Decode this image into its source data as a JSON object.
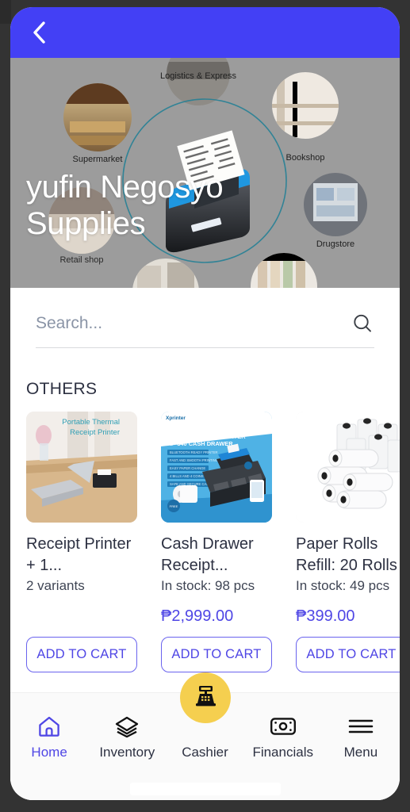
{
  "app": {
    "accent_color": "#4f46e5",
    "appbar_color": "#4340f5",
    "fab_color": "#f5cf4f"
  },
  "appbar": {
    "back_icon": "chevron-left-icon"
  },
  "hero": {
    "store_name": "yufin Negosyo Supplies",
    "banner_labels": [
      "Logistics & Express",
      "Bookshop",
      "Supermarket",
      "Drugstore",
      "Retail shop"
    ]
  },
  "search": {
    "placeholder": "Search...",
    "value": "",
    "icon": "search-icon"
  },
  "section": {
    "title": "OTHERS"
  },
  "products": [
    {
      "name": "Receipt Printer + 1...",
      "subtitle": "2 variants",
      "price": "",
      "button_label": "ADD TO CART",
      "image_alt": "Portable Thermal Receipt Printer"
    },
    {
      "name": "Cash Drawer Receipt...",
      "subtitle": "In stock: 98 pcs",
      "price": "₱2,999.00",
      "button_label": "ADD TO CART",
      "image_alt": "XP-58IIH Receipt Printer XP-340 Cash Drawer Combo Set"
    },
    {
      "name": "Paper Rolls Refill: 20 Rolls",
      "subtitle": "In stock: 49 pcs",
      "price": "₱399.00",
      "button_label": "ADD TO CART",
      "image_alt": "Thermal paper rolls stack"
    }
  ],
  "bottom_nav": [
    {
      "label": "Home",
      "icon": "home-icon",
      "active": true
    },
    {
      "label": "Inventory",
      "icon": "layers-icon",
      "active": false
    },
    {
      "label": "Cashier",
      "icon": "cash-register-icon",
      "active": false
    },
    {
      "label": "Financials",
      "icon": "banknote-icon",
      "active": false
    },
    {
      "label": "Menu",
      "icon": "hamburger-icon",
      "active": false
    }
  ]
}
